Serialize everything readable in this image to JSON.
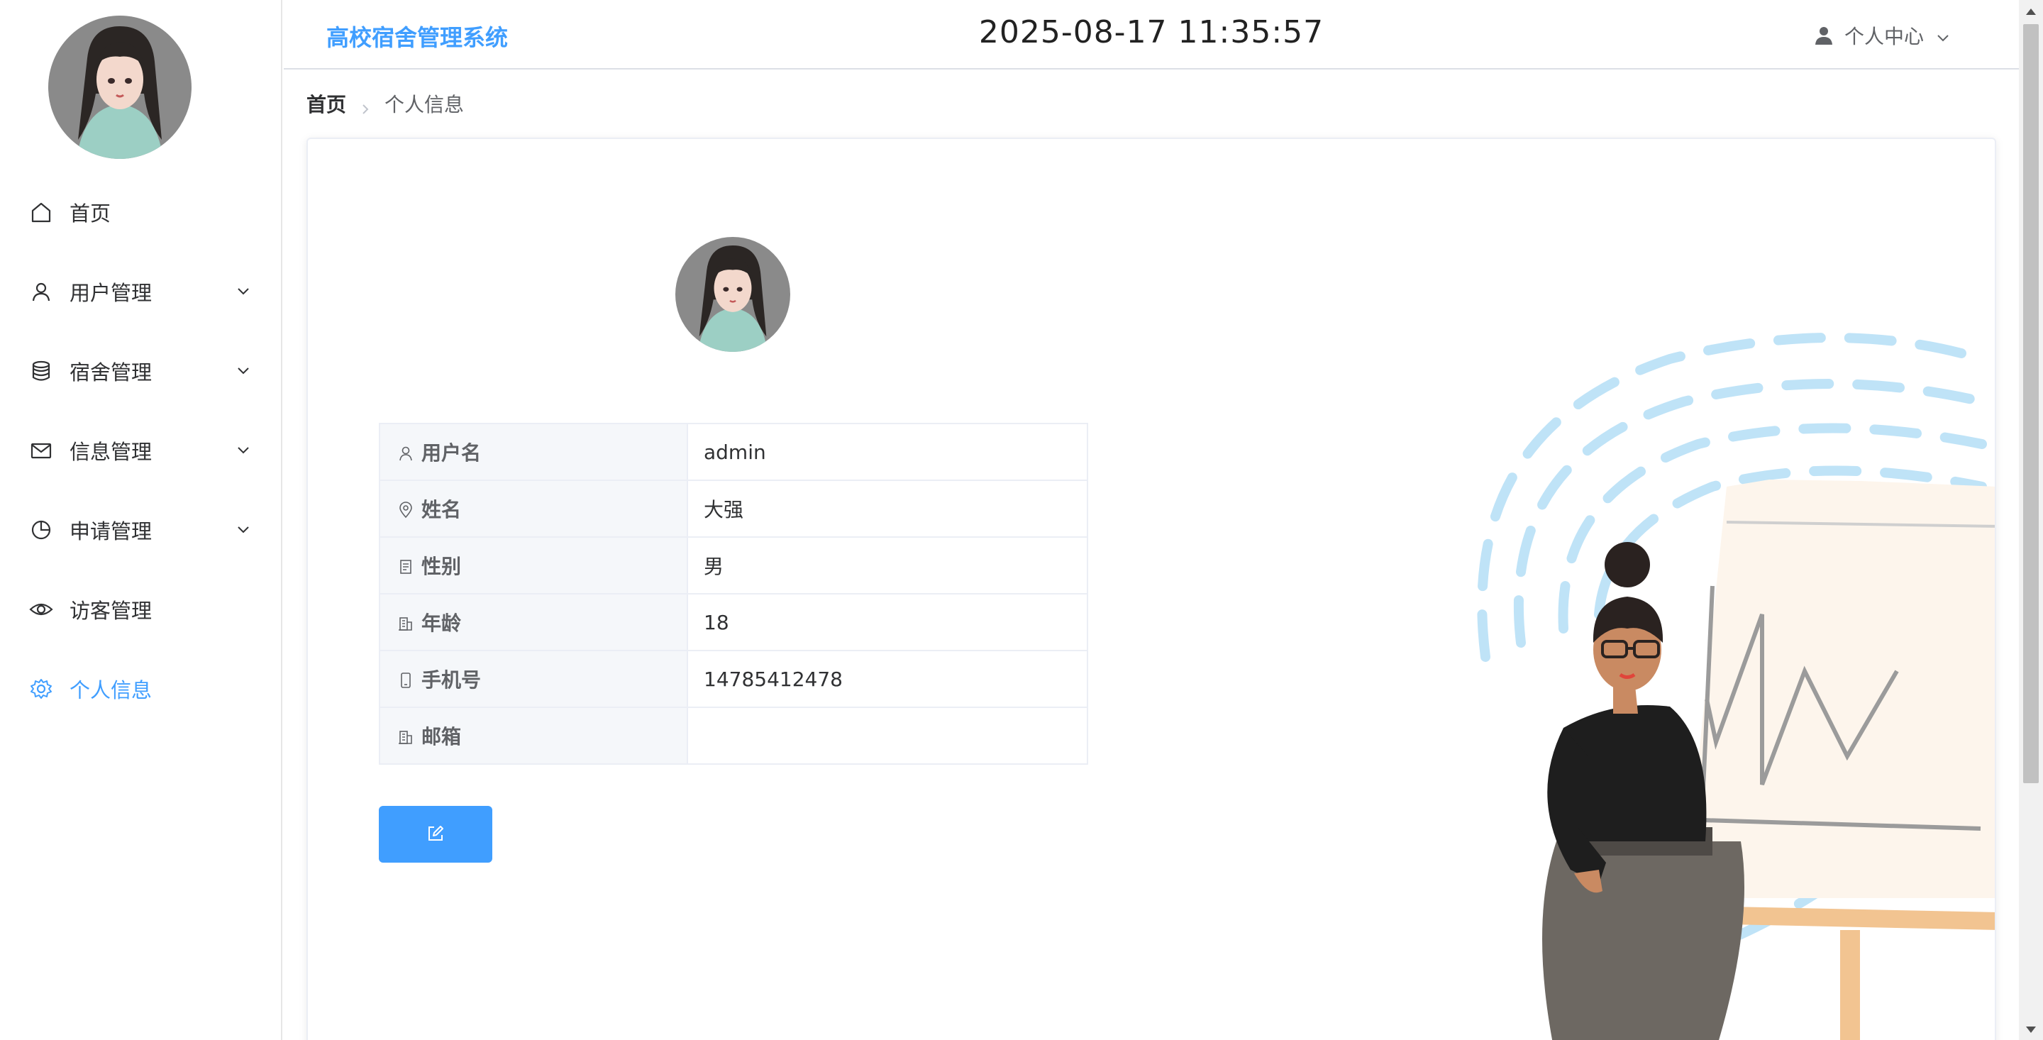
{
  "header": {
    "brand": "高校宿舍管理系统",
    "datetime": "2025-08-17 11:35:57",
    "user_menu_label": "个人中心"
  },
  "sidebar": {
    "items": [
      {
        "label": "首页",
        "icon": "home-icon",
        "has_submenu": false
      },
      {
        "label": "用户管理",
        "icon": "user-icon",
        "has_submenu": true
      },
      {
        "label": "宿舍管理",
        "icon": "database-icon",
        "has_submenu": true
      },
      {
        "label": "信息管理",
        "icon": "mail-icon",
        "has_submenu": true
      },
      {
        "label": "申请管理",
        "icon": "pie-chart-icon",
        "has_submenu": true
      },
      {
        "label": "访客管理",
        "icon": "eye-icon",
        "has_submenu": false
      },
      {
        "label": "个人信息",
        "icon": "gear-icon",
        "has_submenu": false,
        "active": true
      }
    ]
  },
  "breadcrumb": {
    "home": "首页",
    "current": "个人信息"
  },
  "profile": {
    "rows": [
      {
        "label": "用户名",
        "icon": "user-icon",
        "value": "admin"
      },
      {
        "label": "姓名",
        "icon": "location-icon",
        "value": "大强"
      },
      {
        "label": "性别",
        "icon": "document-icon",
        "value": "男"
      },
      {
        "label": "年龄",
        "icon": "office-building-icon",
        "value": "18"
      },
      {
        "label": "手机号",
        "icon": "mobile-phone-icon",
        "value": "14785412478"
      },
      {
        "label": "邮箱",
        "icon": "office-building-icon",
        "value": ""
      }
    ],
    "edit_button_icon": "edit-icon"
  },
  "colors": {
    "accent": "#409eff",
    "label_bg": "#f5f7fa",
    "border": "#ebeef5"
  }
}
